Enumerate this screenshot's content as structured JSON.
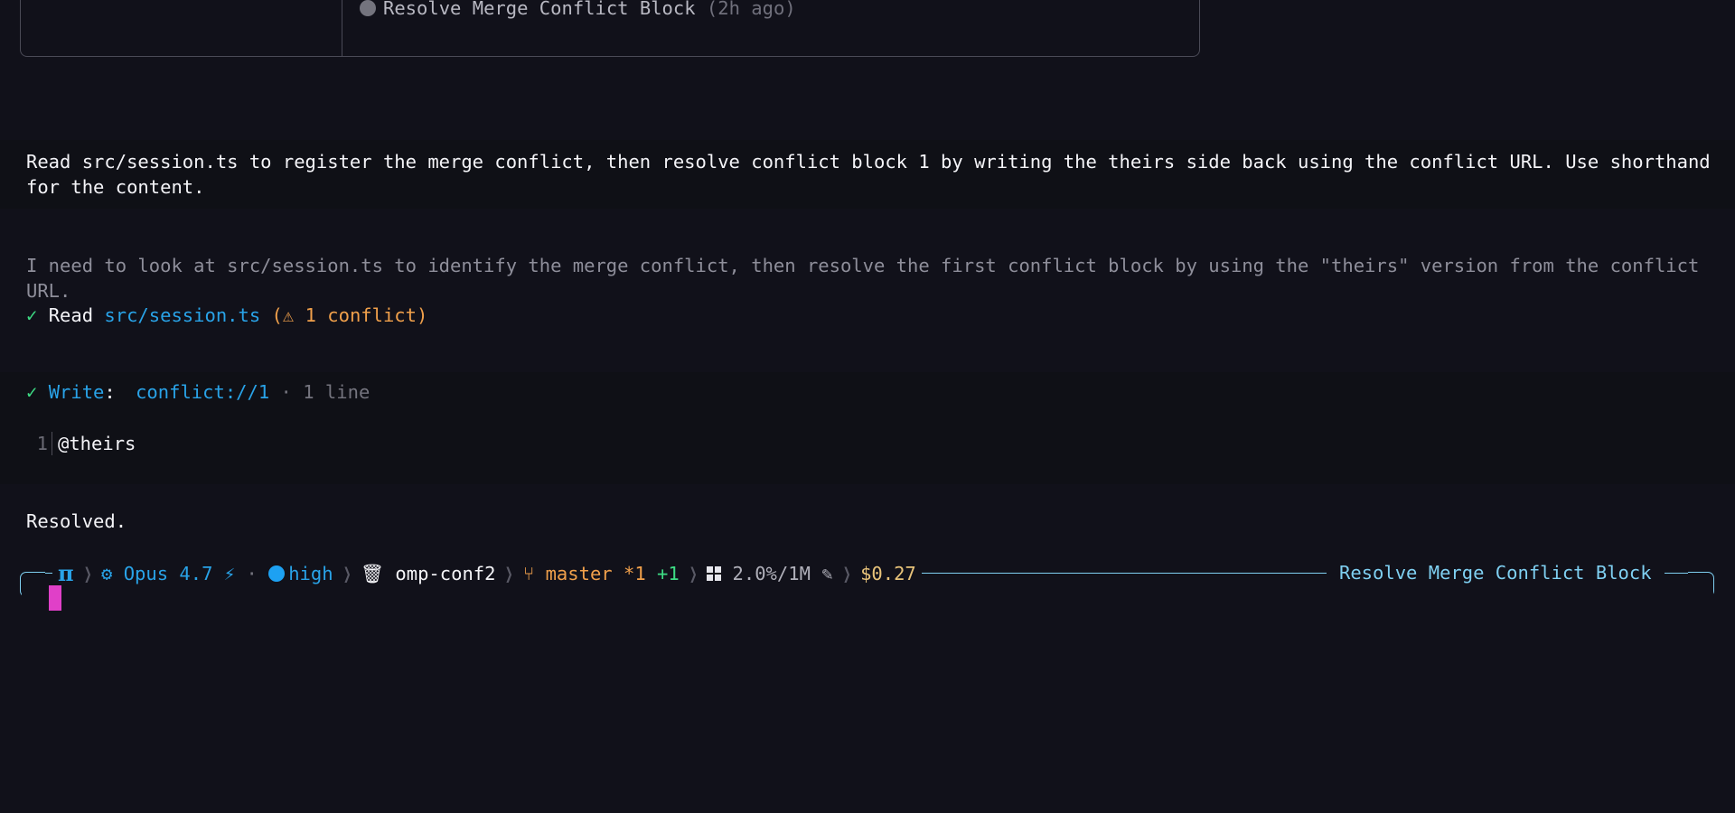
{
  "session_list": {
    "item_name": "Resolve Merge Conflict Block",
    "item_age": "(2h ago)"
  },
  "user_message": "Read src/session.ts to register the merge conflict, then resolve conflict block 1 by writing the theirs side back using the conflict URL. Use shorthand for the content.",
  "assistant_thinking": "I need to look at src/session.ts to identify the merge conflict, then resolve the first conflict block by using the \"theirs\" version from the conflict URL.",
  "read_tool": {
    "check": "✓",
    "verb": "Read",
    "path": "src/session.ts",
    "warning": "(⚠ 1 conflict)"
  },
  "write_tool": {
    "check": "✓",
    "verb": "Write",
    "colon": ":",
    "target": "conflict://1",
    "meta": "· 1 line",
    "lines": [
      {
        "number": "1",
        "text": "@theirs"
      }
    ]
  },
  "final_message": "Resolved.",
  "status_bar": {
    "logo": "π",
    "model": "Opus 4.7",
    "fast_icon": "⚡",
    "dot": "·",
    "thinking_level": "high",
    "project": "omp-conf2",
    "branch": "master",
    "branch_modified": "*1",
    "branch_ahead": "+1",
    "context": "2.0%/1M",
    "cost": "$0.27",
    "session_title": "Resolve Merge Conflict Block"
  },
  "colors": {
    "accent_blue": "#29a3e8",
    "success_green": "#3ddc84",
    "warning_orange": "#f0a04b",
    "cursor_pink": "#e040c8",
    "status_line_cyan": "#7fd0f2"
  }
}
